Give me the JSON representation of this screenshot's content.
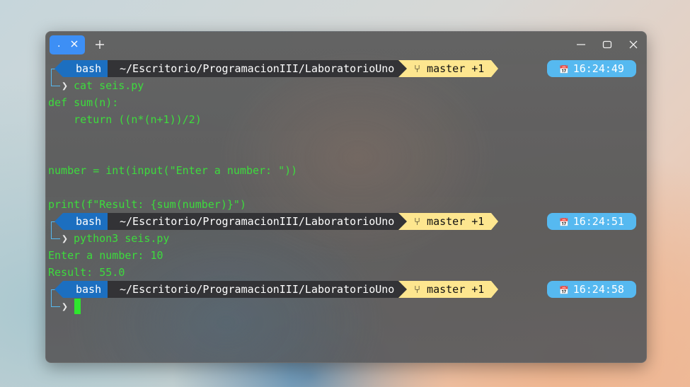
{
  "window": {
    "tab_title": ".",
    "accent": "#3d8ff5",
    "icons": [
      "close-icon",
      "plus-icon",
      "minimize-icon",
      "maximize-icon",
      "close-window-icon"
    ]
  },
  "prompt": {
    "shell": "bash",
    "path": "~/Escritorio/ProgramacionIII/LaboratorioUno",
    "branch_icon": "git-branch-icon",
    "branch": "master +1",
    "caret": "❯",
    "colors": {
      "shell_bg": "#1c6fc0",
      "path_bg": "#333336",
      "git_bg": "#fde68f",
      "time_bg": "#56b9f0",
      "text": "#3ddc3d"
    }
  },
  "blocks": [
    {
      "time": "16:24:49",
      "command": "cat seis.py",
      "output": [
        "def sum(n):",
        "    return ((n*(n+1))/2)",
        "",
        "",
        "number = int(input(\"Enter a number: \"))",
        "",
        "print(f\"Result: {sum(number)}\")"
      ]
    },
    {
      "time": "16:24:51",
      "command": "python3 seis.py",
      "output": [
        "Enter a number: 10",
        "Result: 55.0"
      ]
    },
    {
      "time": "16:24:58",
      "command": "",
      "output": []
    }
  ]
}
